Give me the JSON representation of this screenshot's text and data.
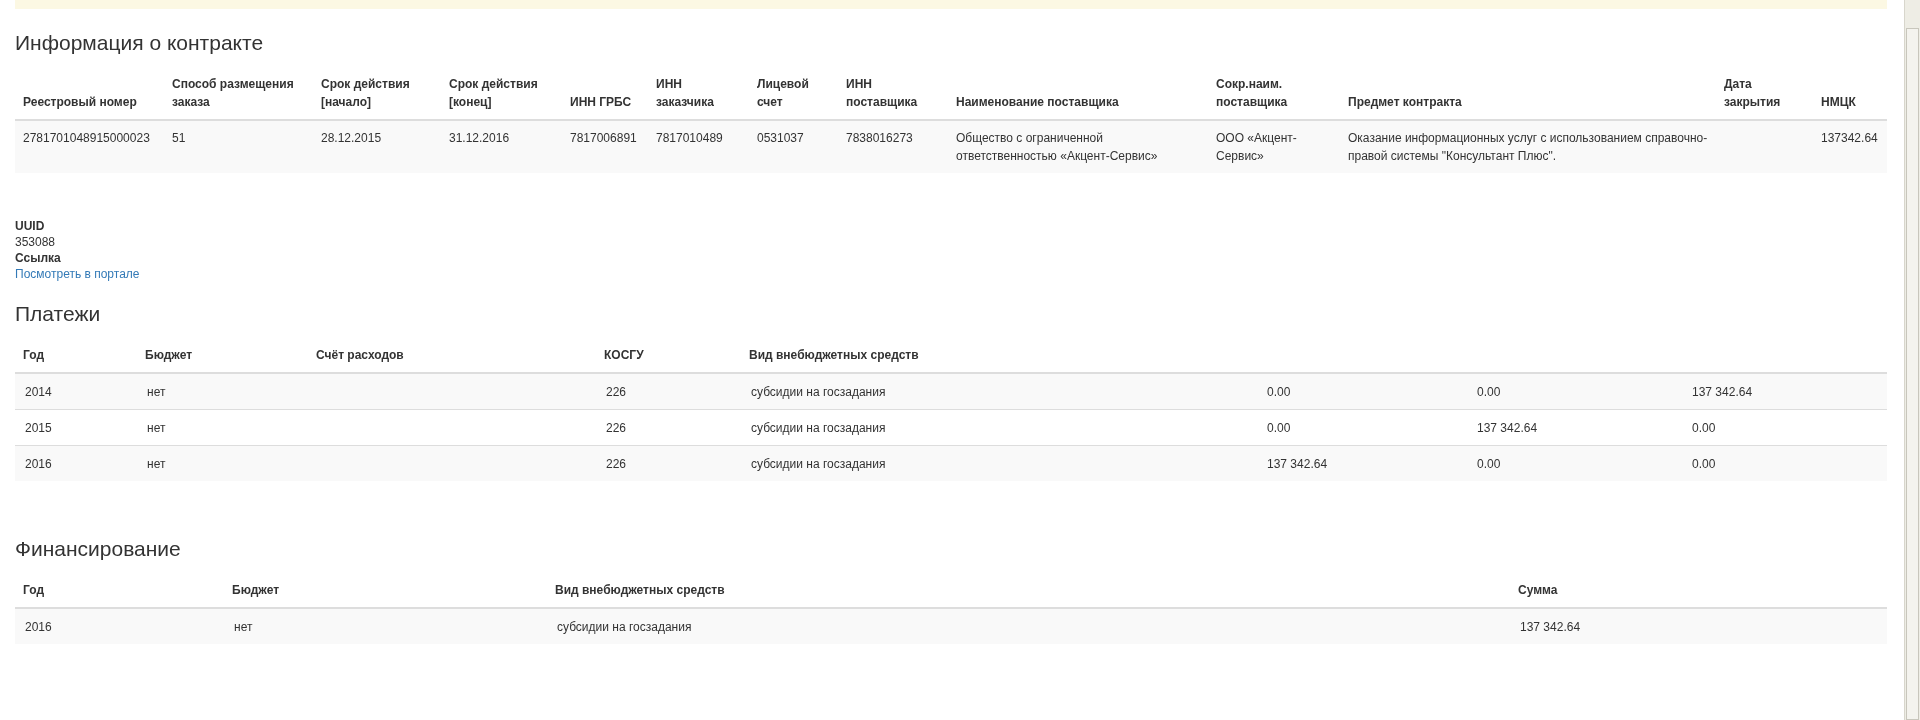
{
  "contract": {
    "title": "Информация о контракте",
    "columns": [
      "Реестровый номер",
      "Способ размещения заказа",
      "Срок действия [начало]",
      "Срок действия [конец]",
      "ИНН ГРБС",
      "ИНН заказчика",
      "Лицевой счет",
      "ИНН поставщика",
      "Наименование поставщика",
      "Сокр.наим. поставщика",
      "Предмет контракта",
      "Дата закрытия",
      "НМЦК"
    ],
    "rows": [
      [
        "2781701048915000023",
        "51",
        "28.12.2015",
        "31.12.2016",
        "7817006891",
        "7817010489",
        "0531037",
        "7838016273",
        "Общество с ограниченной ответственностью «Акцент-Сервис»",
        "ООО «Акцент-Сервис»",
        "Оказание информационных услуг с использованием справочно-правой системы \"Консультант Плюс\".",
        "",
        "137342.64"
      ]
    ]
  },
  "details": [
    {
      "label": "UUID",
      "value": "353088",
      "kind": "text"
    },
    {
      "label": "Ссылка",
      "value": "Посмотреть в портале",
      "kind": "link"
    }
  ],
  "payments": {
    "title": "Платежи",
    "columns": [
      "Год",
      "Бюджет",
      "Счёт расходов",
      "КОСГУ",
      "Вид внебюджетных средств"
    ],
    "rows": [
      [
        "2014",
        "нет",
        "",
        "226",
        "субсидии на госзадания",
        "0.00",
        "0.00",
        "137 342.64"
      ],
      [
        "2015",
        "нет",
        "",
        "226",
        "субсидии на госзадания",
        "0.00",
        "137 342.64",
        "0.00"
      ],
      [
        "2016",
        "нет",
        "",
        "226",
        "субсидии на госзадания",
        "137 342.64",
        "0.00",
        "0.00"
      ]
    ]
  },
  "financing": {
    "title": "Финансирование",
    "columns": [
      "Год",
      "Бюджет",
      "Вид внебюджетных средств",
      "Сумма"
    ],
    "rows": [
      [
        "2016",
        "нет",
        "субсидии на госзадания",
        "137 342.64"
      ]
    ]
  }
}
